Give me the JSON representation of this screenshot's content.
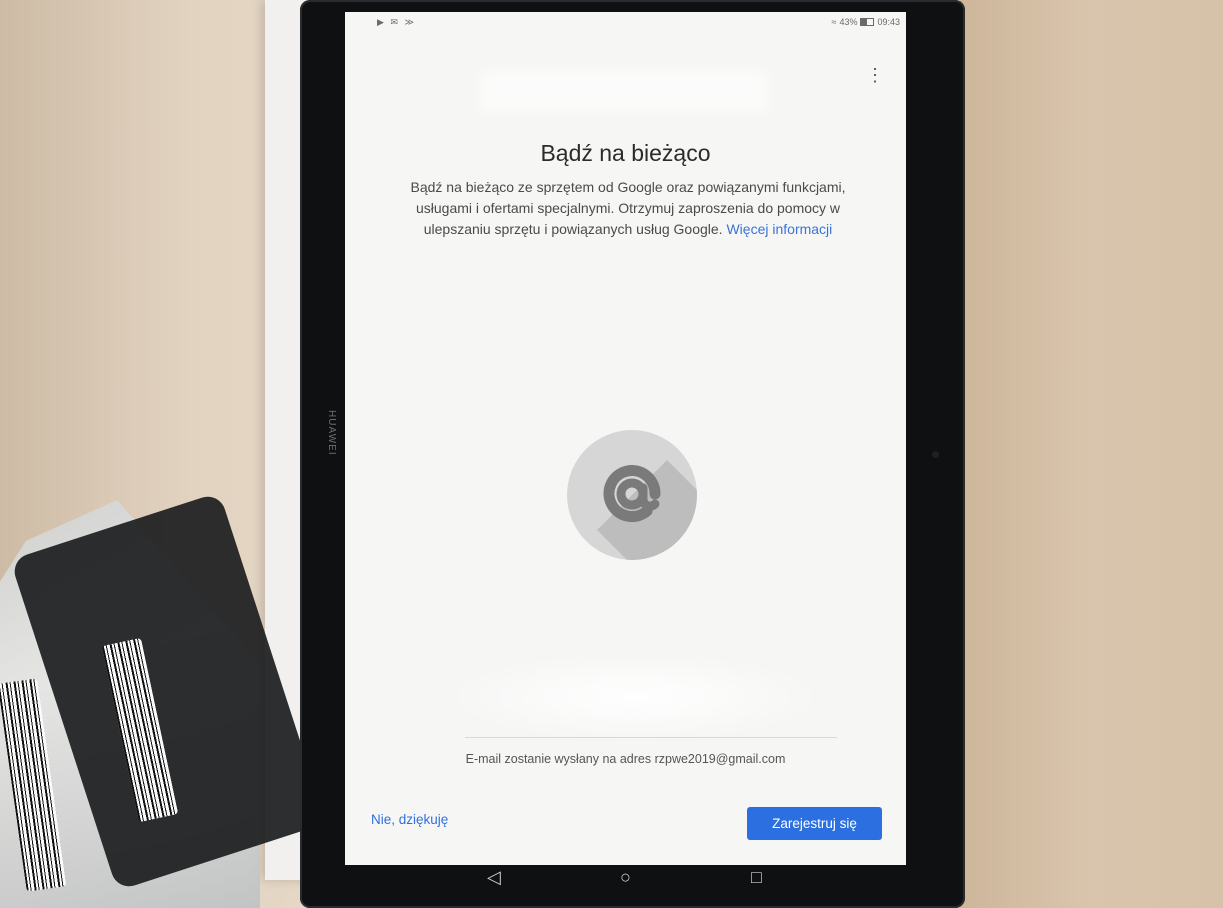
{
  "device": {
    "brand": "HUAWEI"
  },
  "status_bar": {
    "left_icons": "▶ ✉ ≫",
    "signal": "≈",
    "battery": "43%",
    "time": "09:43"
  },
  "menu": {
    "more_icon": "⋮"
  },
  "content": {
    "title": "Bądź na bieżąco",
    "body": "Bądź na bieżąco ze sprzętem od Google oraz powiązanymi funkcjami, usługami i ofertami specjalnymi. Otrzymuj zaproszenia do pomocy w ulepszaniu sprzętu i powiązanych usług Google.",
    "link": "Więcej informacji",
    "illustration_icon": "at-sign-icon",
    "email_note": "E-mail zostanie wysłany na adres rzpwe2019@gmail.com"
  },
  "actions": {
    "decline": "Nie, dziękuję",
    "accept": "Zarejestruj się",
    "accent_color": "#2c6fe0"
  },
  "navigation": {
    "back": "◁",
    "home": "○",
    "recent": "□"
  }
}
